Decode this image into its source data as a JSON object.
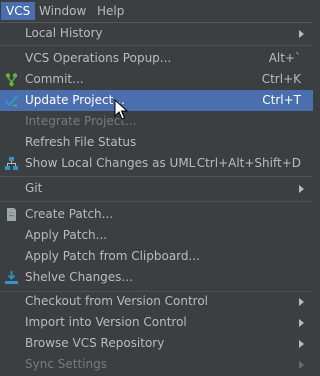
{
  "menubar": {
    "vcs": "VCS",
    "window": "Window",
    "help": "Help"
  },
  "menu": {
    "local_history": "Local History",
    "vcs_operations_popup": "VCS Operations Popup...",
    "vcs_operations_popup_shortcut": "Alt+`",
    "commit": "Commit...",
    "commit_shortcut": "Ctrl+K",
    "update_project": "Update Project...",
    "update_project_shortcut": "Ctrl+T",
    "integrate_project": "Integrate Project...",
    "refresh_file_status": "Refresh File Status",
    "show_local_changes_uml": "Show Local Changes as UML",
    "show_local_changes_uml_shortcut": "Ctrl+Alt+Shift+D",
    "git": "Git",
    "create_patch": "Create Patch...",
    "apply_patch": "Apply Patch...",
    "apply_patch_from_clipboard": "Apply Patch from Clipboard...",
    "shelve_changes": "Shelve Changes...",
    "checkout_from_vcs": "Checkout from Version Control",
    "import_into_vcs": "Import into Version Control",
    "browse_vcs_repository": "Browse VCS Repository",
    "sync_settings": "Sync Settings"
  },
  "colors": {
    "background": "#3c3f41",
    "selection": "#4b6eaf",
    "text": "#bbbbbb",
    "disabled_text": "#7a7a7a"
  },
  "icons": {
    "commit": "vcs-commit-icon",
    "update": "vcs-update-checkmark-icon",
    "uml": "uml-diagram-icon",
    "patch": "patch-file-icon",
    "shelve": "shelve-download-icon",
    "cursor": "mouse-pointer-icon"
  }
}
